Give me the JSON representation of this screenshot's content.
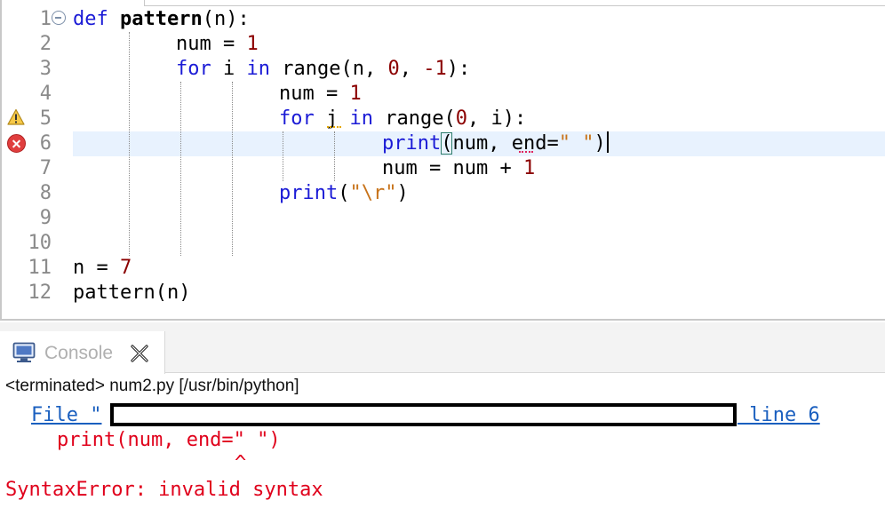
{
  "editor": {
    "line_numbers": [
      "1",
      "2",
      "3",
      "4",
      "5",
      "6",
      "7",
      "8",
      "9",
      "10",
      "11",
      "12"
    ],
    "code": {
      "l1_kw": "def",
      "l1_name": "pattern",
      "l1_rest": "(n):",
      "l2_a": "num = ",
      "l2_num": "1",
      "l3_for": "for",
      "l3_mid": " i ",
      "l3_in": "in",
      "l3_rest": " range(n, ",
      "l3_n1": "0",
      "l3_sep": ", ",
      "l3_n2": "-1",
      "l3_end": "):",
      "l4_a": "num = ",
      "l4_num": "1",
      "l5_for": "for",
      "l5_mid": " j ",
      "l5_in": "in",
      "l5_rest": " range(",
      "l5_n1": "0",
      "l5_end": ", i):",
      "l6_print": "print",
      "l6_paren": "(",
      "l6_mid": "num, end=",
      "l6_str": "\" \"",
      "l6_end": ")",
      "l7_a": "num = num + ",
      "l7_num": "1",
      "l8_print": "print",
      "l8_open": "(",
      "l8_str": "\"\\r\"",
      "l8_close": ")",
      "l11_a": "n = ",
      "l11_num": "7",
      "l12": "pattern(n)"
    },
    "markers": {
      "line5": "warning-icon",
      "line6": "error-icon"
    },
    "colors": {
      "keyword": "#1b1bd6",
      "number": "#8b0000",
      "string": "#c8731a",
      "current_line": "#e8f2fe"
    }
  },
  "console": {
    "tab_label": "Console",
    "status": "<terminated> num2.py [/usr/bin/python]",
    "file_prefix": "File \"",
    "line_ref": " line 6",
    "error_code_line": "print(num, end=\" \")",
    "caret": "^",
    "error_message": "SyntaxError: invalid syntax",
    "colors": {
      "link": "#1a5fbf",
      "error": "#e0001b"
    }
  }
}
